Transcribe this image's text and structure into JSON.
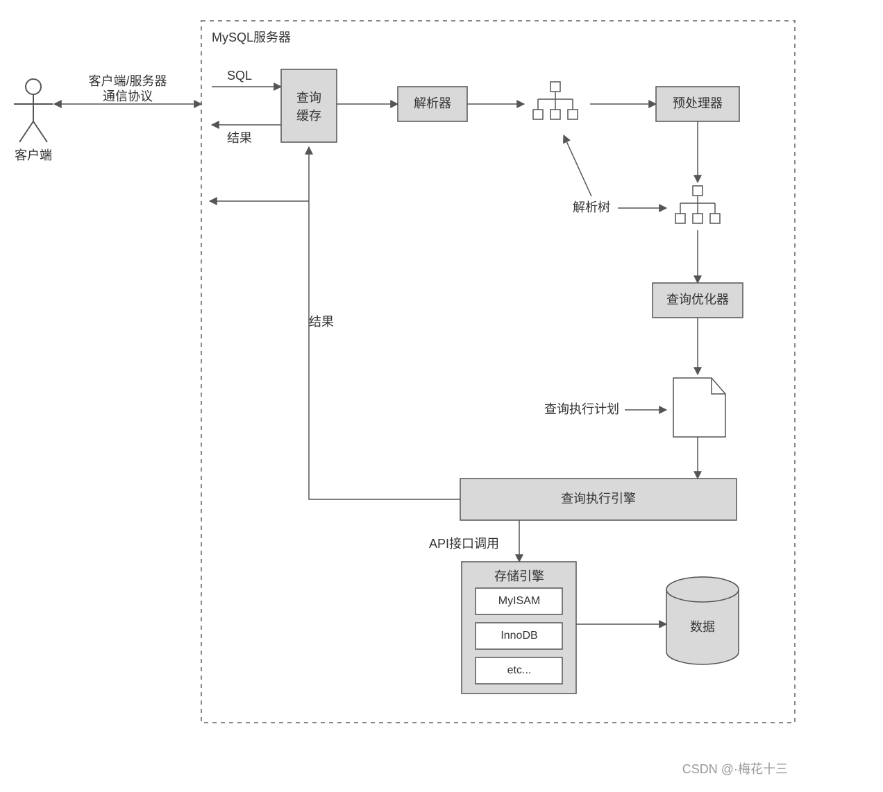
{
  "client_label": "客户端",
  "protocol_line1": "客户端/服务器",
  "protocol_line2": "通信协议",
  "server_title": "MySQL服务器",
  "sql_label": "SQL",
  "result_label_1": "结果",
  "result_label_2": "结果",
  "cache_line1": "查询",
  "cache_line2": "缓存",
  "parser": "解析器",
  "preprocessor": "预处理器",
  "parse_tree": "解析树",
  "optimizer": "查询优化器",
  "exec_plan": "查询执行计划",
  "exec_engine": "查询执行引擎",
  "api_call": "API接口调用",
  "storage_engine": "存储引擎",
  "engines": [
    "MyISAM",
    "InnoDB",
    "etc..."
  ],
  "data_label": "数据",
  "watermark": "CSDN @·梅花十三"
}
